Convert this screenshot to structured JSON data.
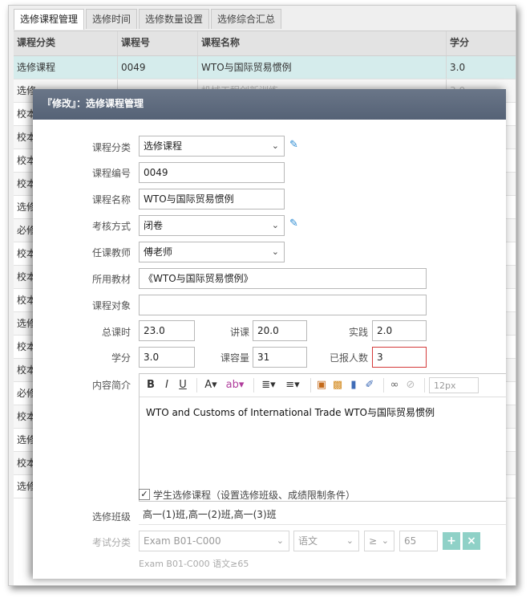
{
  "tabs": [
    "选修课程管理",
    "选修时间",
    "选修数量设置",
    "选修综合汇总"
  ],
  "grid": {
    "headers": [
      "课程分类",
      "课程号",
      "课程名称",
      "学分"
    ],
    "rows": [
      {
        "cat": "选修课程",
        "code": "0049",
        "name": "WTO与国际贸易惯例",
        "credit": "3.0"
      },
      {
        "cat": "选修",
        "code": "",
        "name": "机械工程创新训练",
        "credit": "3.0"
      },
      {
        "cat": "校本",
        "code": "",
        "name": "",
        "credit": ""
      },
      {
        "cat": "校本",
        "code": "",
        "name": "",
        "credit": ""
      },
      {
        "cat": "校本",
        "code": "",
        "name": "",
        "credit": ""
      },
      {
        "cat": "校本",
        "code": "",
        "name": "",
        "credit": ""
      },
      {
        "cat": "选修",
        "code": "",
        "name": "",
        "credit": ""
      },
      {
        "cat": "必修",
        "code": "",
        "name": "",
        "credit": ""
      },
      {
        "cat": "校本",
        "code": "",
        "name": "",
        "credit": ""
      },
      {
        "cat": "校本",
        "code": "",
        "name": "",
        "credit": ""
      },
      {
        "cat": "校本",
        "code": "",
        "name": "",
        "credit": ""
      },
      {
        "cat": "选修",
        "code": "",
        "name": "",
        "credit": ""
      },
      {
        "cat": "校本",
        "code": "",
        "name": "",
        "credit": ""
      },
      {
        "cat": "校本",
        "code": "",
        "name": "",
        "credit": ""
      },
      {
        "cat": "必修",
        "code": "",
        "name": "",
        "credit": ""
      },
      {
        "cat": "校本",
        "code": "",
        "name": "",
        "credit": ""
      },
      {
        "cat": "选修",
        "code": "",
        "name": "",
        "credit": ""
      },
      {
        "cat": "校本",
        "code": "",
        "name": "",
        "credit": ""
      },
      {
        "cat": "选修",
        "code": "",
        "name": "",
        "credit": ""
      }
    ]
  },
  "dialog": {
    "title": "『修改』：选修课程管理",
    "labels": {
      "category": "课程分类",
      "code": "课程编号",
      "name": "课程名称",
      "exam": "考核方式",
      "teacher": "任课教师",
      "textbook": "所用教材",
      "target": "课程对象",
      "total_hours": "总课时",
      "lecture": "讲课",
      "practice": "实践",
      "credit": "学分",
      "capacity": "课容量",
      "enrolled": "已报人数",
      "intro": "内容简介",
      "classes": "选修班级",
      "exam_cat": "考试分类"
    },
    "values": {
      "category": "选修课程",
      "code": "0049",
      "name": "WTO与国际贸易惯例",
      "exam": "闭卷",
      "teacher": "傅老师",
      "textbook": "《WTO与国际贸易惯例》",
      "target": "",
      "total_hours": "23.0",
      "lecture": "20.0",
      "practice": "2.0",
      "credit": "3.0",
      "capacity": "31",
      "enrolled": "3",
      "intro": "WTO and Customs of International Trade WTO与国际贸易惯例",
      "student_choose": "学生选修课程（设置选修班级、成绩限制条件）",
      "classes": "高一(1)班,高一(2)班,高一(3)班",
      "exam_cat": "Exam B01-C000",
      "subject": "语文",
      "op": "≥",
      "score": "65",
      "condition_text": "Exam B01-C000 语文≥65"
    },
    "toolbar": {
      "font_size": "12px"
    }
  }
}
